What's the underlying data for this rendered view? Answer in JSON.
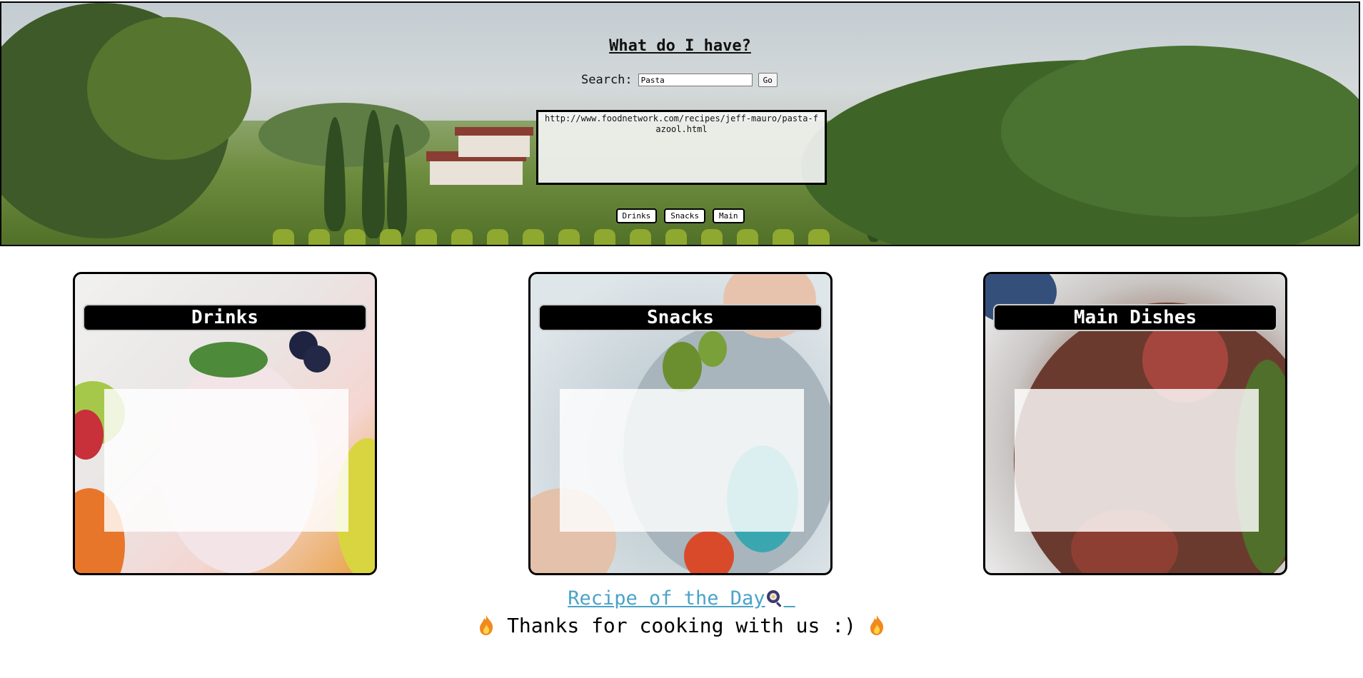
{
  "hero": {
    "title": "What do I have?",
    "search_label": "Search:",
    "search_value": "Pasta",
    "go_label": "Go",
    "result_text": "http://www.foodnetwork.com/recipes/jeff-mauro/pasta-fazool.html",
    "categories": [
      "Drinks",
      "Snacks",
      "Main"
    ]
  },
  "cards": [
    {
      "title": "Drinks"
    },
    {
      "title": "Snacks"
    },
    {
      "title": "Main Dishes"
    }
  ],
  "footer": {
    "recipe_link": "Recipe of the Day",
    "thanks": "Thanks for cooking with us :)"
  },
  "colors": {
    "link": "#4aa3c8",
    "banner": "#000000",
    "flame": "#f08a1c"
  }
}
